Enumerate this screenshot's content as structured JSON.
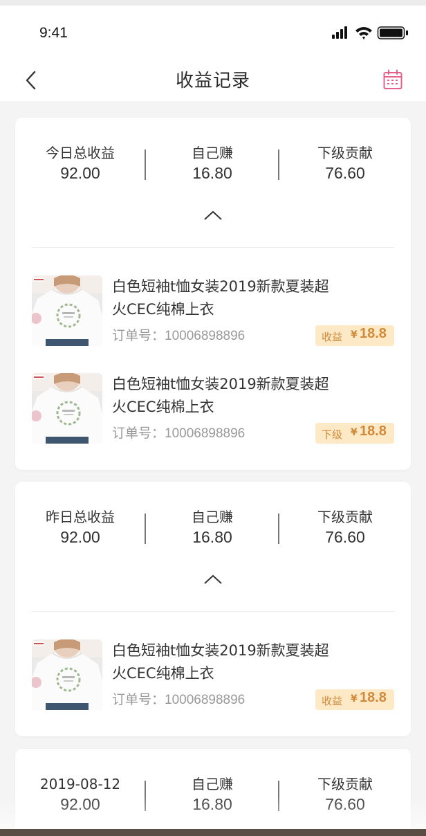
{
  "status": {
    "time": "9:41"
  },
  "nav": {
    "title": "收益记录"
  },
  "colors": {
    "accent": "#e8608a",
    "badge_bg": "#fde9c6",
    "badge_text": "#d08a3b"
  },
  "icons": {
    "back": "chevron-left-icon",
    "calendar": "calendar-icon",
    "collapse": "chevron-up-icon"
  },
  "groups": [
    {
      "summary": {
        "total_label": "今日总收益",
        "total_value": "92.00",
        "self_label": "自己赚",
        "self_value": "16.80",
        "sub_label": "下级贡献",
        "sub_value": "76.60"
      },
      "items": [
        {
          "title": "白色短袖t恤女装2019新款夏装超火CEC纯棉上衣",
          "order_label": "订单号：",
          "order_no": "10006898896",
          "badge_type": "收益",
          "currency": "¥",
          "amount": "18.8"
        },
        {
          "title": "白色短袖t恤女装2019新款夏装超火CEC纯棉上衣",
          "order_label": "订单号：",
          "order_no": "10006898896",
          "badge_type": "下级",
          "currency": "¥",
          "amount": "18.8"
        }
      ]
    },
    {
      "summary": {
        "total_label": "昨日总收益",
        "total_value": "92.00",
        "self_label": "自己赚",
        "self_value": "16.80",
        "sub_label": "下级贡献",
        "sub_value": "76.60"
      },
      "items": [
        {
          "title": "白色短袖t恤女装2019新款夏装超火CEC纯棉上衣",
          "order_label": "订单号：",
          "order_no": "10006898896",
          "badge_type": "收益",
          "currency": "¥",
          "amount": "18.8"
        }
      ]
    },
    {
      "summary": {
        "total_label": "2019-08-12",
        "total_value": "92.00",
        "self_label": "自己赚",
        "self_value": "16.80",
        "sub_label": "下级贡献",
        "sub_value": "76.60"
      },
      "items": []
    }
  ]
}
